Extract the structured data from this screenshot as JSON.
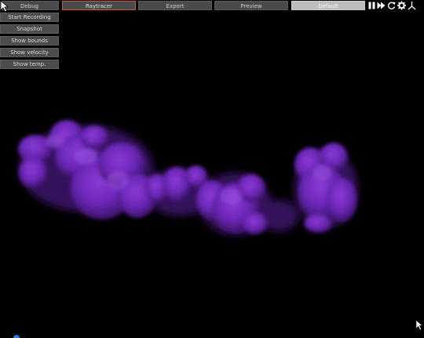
{
  "tabs": {
    "debug": "Debug",
    "raytracer": "Raytracer",
    "export": "Export",
    "preview": "Preview",
    "default": "Default"
  },
  "sidebar": {
    "items": [
      "Start Recording",
      "Snapshot",
      "Show bounds",
      "Show velocity",
      "Show temp."
    ]
  },
  "toolbar": {
    "icons": [
      "pause-icon",
      "fast-forward-icon",
      "refresh-icon",
      "gear-icon",
      "axes-icon"
    ]
  },
  "colors": {
    "smoke": "#7a2fc8",
    "accent": "#d2553a",
    "panel": "#4c4c4c",
    "background": "#000000"
  }
}
